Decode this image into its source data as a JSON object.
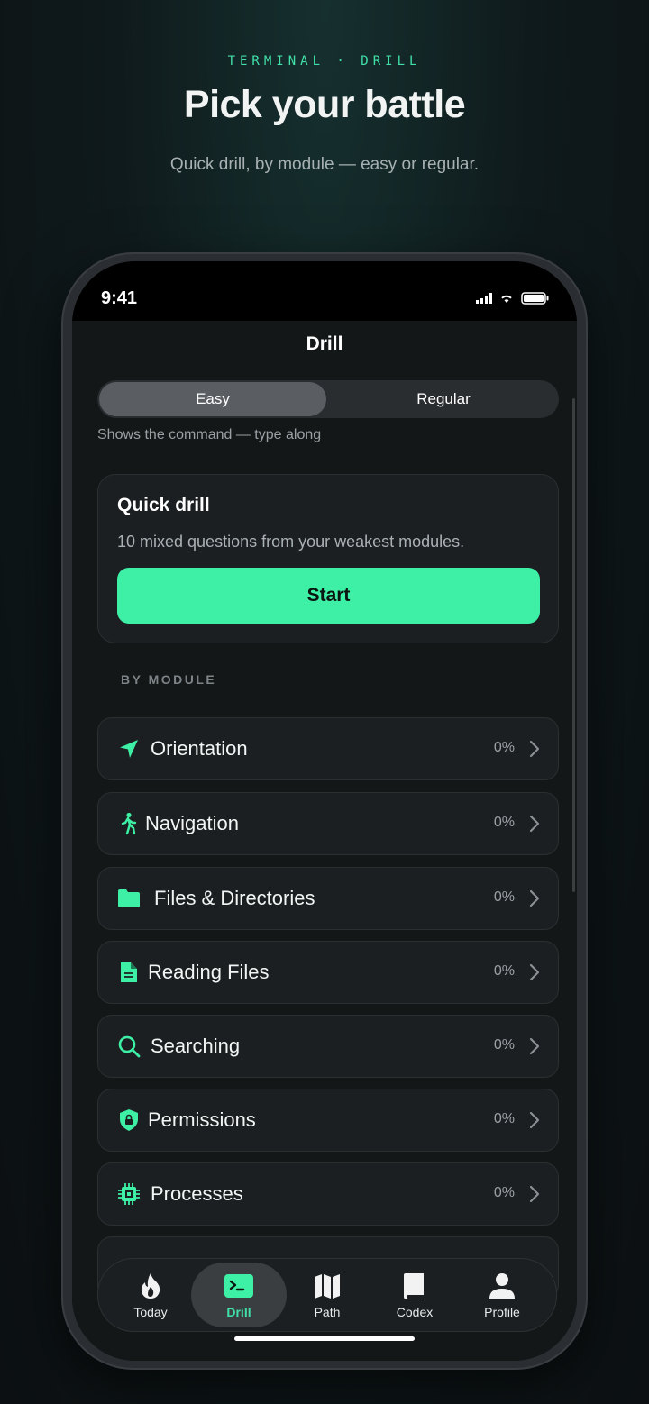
{
  "promo": {
    "eyebrow": "TERMINAL · DRILL",
    "headline": "Pick your battle",
    "subline": "Quick drill, by module — easy or regular."
  },
  "status_bar": {
    "time": "9:41"
  },
  "nav": {
    "title": "Drill"
  },
  "mode": {
    "options": [
      "Easy",
      "Regular"
    ],
    "selected": "Easy",
    "hint": "Shows the command — type along"
  },
  "quick_drill": {
    "title": "Quick drill",
    "description": "10 mixed questions from your weakest modules.",
    "start_label": "Start"
  },
  "section_label": "BY MODULE",
  "modules": [
    {
      "name": "Orientation",
      "progress": "0%",
      "icon": "location-arrow-icon"
    },
    {
      "name": "Navigation",
      "progress": "0%",
      "icon": "walking-icon"
    },
    {
      "name": "Files & Directories",
      "progress": "0%",
      "icon": "folder-icon"
    },
    {
      "name": "Reading Files",
      "progress": "0%",
      "icon": "document-icon"
    },
    {
      "name": "Searching",
      "progress": "0%",
      "icon": "search-icon"
    },
    {
      "name": "Permissions",
      "progress": "0%",
      "icon": "shield-lock-icon"
    },
    {
      "name": "Processes",
      "progress": "0%",
      "icon": "cpu-icon"
    }
  ],
  "tabs": [
    {
      "label": "Today",
      "icon": "flame-icon"
    },
    {
      "label": "Drill",
      "icon": "terminal-icon",
      "active": true
    },
    {
      "label": "Path",
      "icon": "map-icon"
    },
    {
      "label": "Codex",
      "icon": "book-icon"
    },
    {
      "label": "Profile",
      "icon": "person-icon"
    }
  ],
  "colors": {
    "accent": "#3ef0a5",
    "background": "#141718",
    "card": "#1b1f21"
  }
}
